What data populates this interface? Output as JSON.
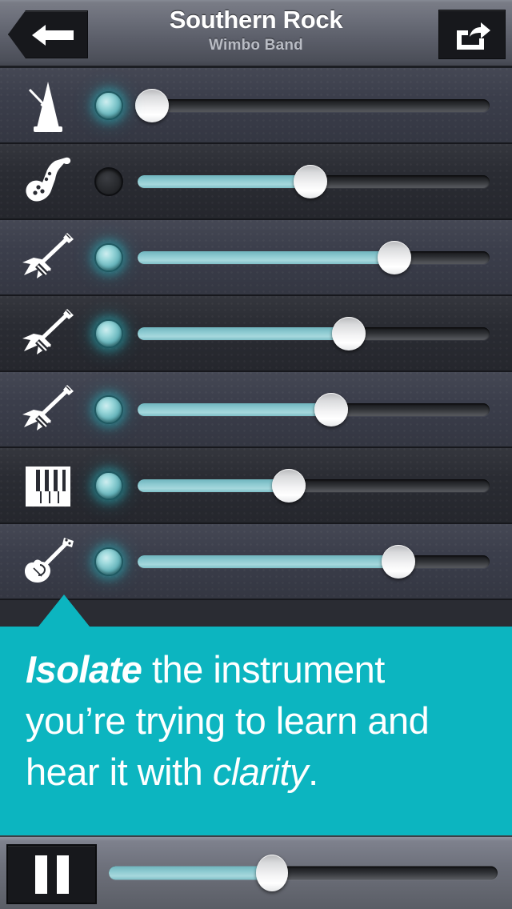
{
  "header": {
    "title": "Southern Rock",
    "artist": "Wimbo Band",
    "back_icon": "back-arrow-icon",
    "share_icon": "share-icon"
  },
  "tracks": [
    {
      "instrument": "metronome",
      "icon": "metronome-icon",
      "led_on": true,
      "volume": 4
    },
    {
      "instrument": "saxophone",
      "icon": "saxophone-icon",
      "led_on": false,
      "volume": 49
    },
    {
      "instrument": "electric-guitar-1",
      "icon": "electric-guitar-icon",
      "led_on": true,
      "volume": 73
    },
    {
      "instrument": "electric-guitar-2",
      "icon": "electric-guitar-icon",
      "led_on": true,
      "volume": 60
    },
    {
      "instrument": "electric-guitar-3",
      "icon": "electric-guitar-icon",
      "led_on": true,
      "volume": 55
    },
    {
      "instrument": "keyboard",
      "icon": "piano-keys-icon",
      "led_on": true,
      "volume": 43
    },
    {
      "instrument": "bass-guitar",
      "icon": "bass-guitar-icon",
      "led_on": true,
      "volume": 74
    }
  ],
  "callout": {
    "word_bold": "Isolate",
    "text_middle": " the instrument you’re trying to learn and hear it with ",
    "word_italic": "clarity",
    "text_end": "."
  },
  "transport": {
    "play_state_icon": "pause-icon",
    "position": 42
  },
  "colors": {
    "accent_banner": "#0CB5C0",
    "slider_fill": "#8ECBD2",
    "led_on": "#69B6BD",
    "row_odd": "#3B3E4B",
    "row_even": "#2A2C33"
  }
}
